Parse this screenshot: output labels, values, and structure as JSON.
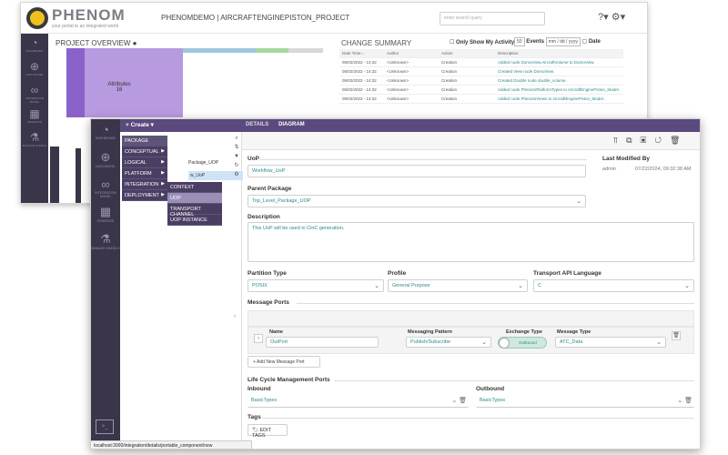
{
  "back": {
    "logo": {
      "name": "PHENOM",
      "tagline": "your portal to an integrated world"
    },
    "project_title": "PHENOMDEMO | AIRCRAFTENGINEPISTON_PROJECT",
    "search_placeholder": "enter search query",
    "project_overview": "PROJECT OVERVIEW",
    "change_summary": "CHANGE SUMMARY",
    "only_show_my_activity": "Only Show My Activity",
    "events_count": "50",
    "events_label": "Events",
    "date_placeholder": "mm / dd / yyyy",
    "date_label": "Date",
    "table": {
      "headers": [
        "Date Time ↓",
        "Author",
        "Action",
        "Description"
      ],
      "rows": [
        [
          "05/02/2022 - 14:32",
          "<Unknown>",
          "Creation",
          "Added node DomoView.AircraftVolume to DomoView."
        ],
        [
          "05/02/2022 - 14:32",
          "<Unknown>",
          "Creation",
          "Created View node DomoView."
        ],
        [
          "05/02/2022 - 14:32",
          "<Unknown>",
          "Creation",
          "Created Double node double_volume."
        ],
        [
          "05/02/2022 - 14:32",
          "<Unknown>",
          "Creation",
          "Added node PhenomPlatformTypes to AircraftEnginePiston_Model."
        ],
        [
          "05/02/2022 - 14:32",
          "<Unknown>",
          "Creation",
          "Added node PhenomViews to AircraftEnginePiston_Model."
        ]
      ]
    },
    "treemap_label": "Attributes",
    "treemap_value": "16",
    "sidebar": [
      "DASHBOARD",
      "DATA MODEL",
      "INTEGRATION MODEL",
      "GENERATE",
      "MANAGE MODELS"
    ]
  },
  "front": {
    "create_label": "+ Create ▾",
    "tabs": [
      "DETAILS",
      "DIAGRAM"
    ],
    "menu1": [
      "PACKAGE",
      "CONCEPTUAL",
      "LOGICAL",
      "PLATFORM",
      "INTEGRATION",
      "DEPLOYMENT"
    ],
    "menu2": [
      "CONTEXT",
      "UOP",
      "TRANSPORT CHANNEL",
      "UOP INSTANCE"
    ],
    "tree_nodes": [
      "Package_UOP",
      "w_UoP"
    ],
    "sidebar": [
      "DASHBOARD",
      "DATA MODEL",
      "INTEGRATION MODEL",
      "GENERATE",
      "MANAGE MODELS"
    ],
    "uop_label": "UoP",
    "uop_value": "Workflow_UoP",
    "last_modified_label": "Last Modified By",
    "last_modified_user": "admin",
    "last_modified_time": "07/22/2024, 09:32:38 AM",
    "parent_package_label": "Parent Package",
    "parent_package_value": "Top_Level_Package_UOP",
    "description_label": "Description",
    "description_value": "This UoP will be used in CinC generation.",
    "partition_type_label": "Partition Type",
    "partition_type_value": "POSIX",
    "profile_label": "Profile",
    "profile_value": "General Purpose",
    "transport_api_label": "Transport API Language",
    "transport_api_value": "C",
    "message_ports_label": "Message Ports",
    "port_name_label": "Name",
    "port_name_value": "OutPort",
    "messaging_pattern_label": "Messaging Pattern",
    "messaging_pattern_value": "Publish/Subscribe",
    "exchange_type_label": "Exchange Type",
    "exchange_type_value": "Outbound",
    "message_type_label": "Message Type",
    "message_type_value": "ATC_Data",
    "add_port_label": "+ Add New Message Port",
    "lcm_ports_label": "Life Cycle Management Ports",
    "inbound_label": "Inbound",
    "inbound_value": "BasicTypes",
    "outbound_label": "Outbound",
    "outbound_value": "BasicTypes",
    "tags_label": "Tags",
    "edit_tags_label": "EDIT TAGS"
  },
  "status_url": "localhost:3000/integration/details/portable_component/new"
}
